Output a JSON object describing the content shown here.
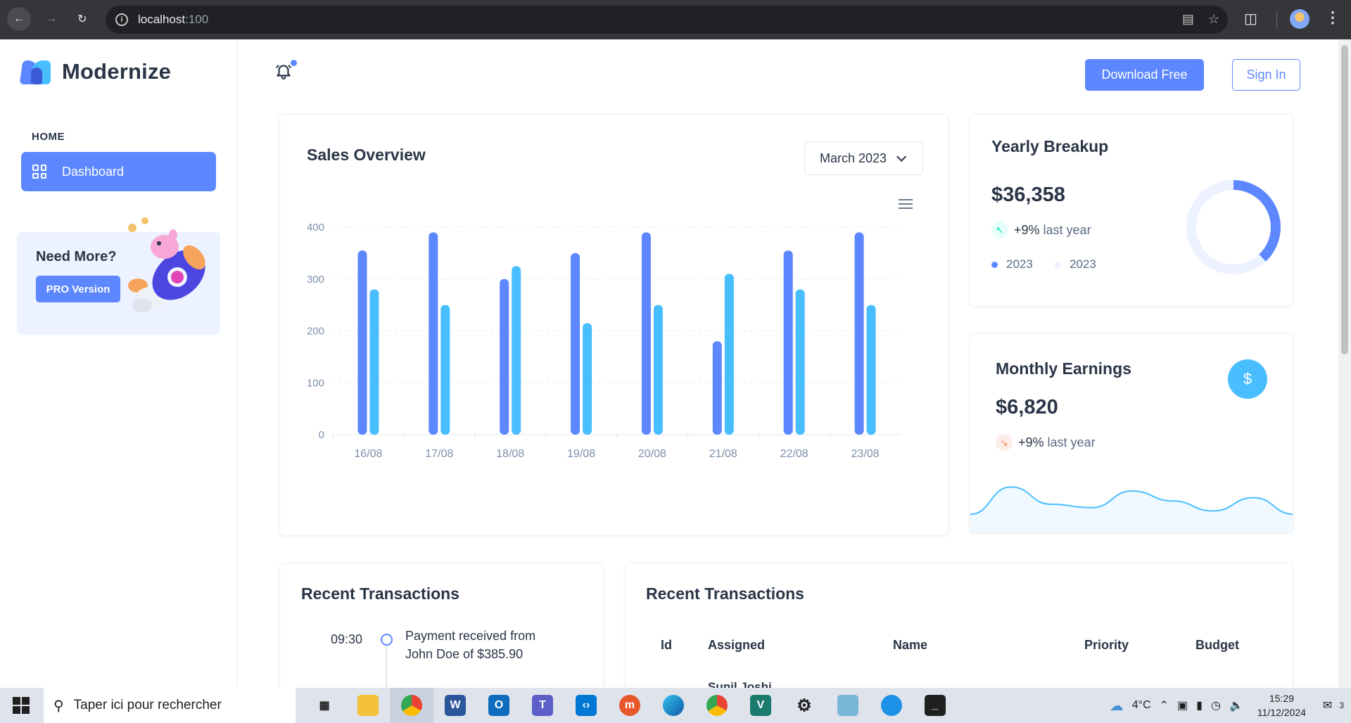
{
  "browser": {
    "url_host": "localhost",
    "url_port": ":100"
  },
  "sidebar": {
    "brand": "Modernize",
    "section_label": "HOME",
    "nav_items": [
      {
        "label": "Dashboard",
        "icon": "dashboard-grid-icon",
        "active": true
      }
    ],
    "promo": {
      "title": "Need More?",
      "button": "PRO Version"
    }
  },
  "header": {
    "notification_icon": "bell-icon",
    "download_button": "Download Free",
    "signin_button": "Sign In"
  },
  "sales_overview": {
    "title": "Sales Overview",
    "period_select": "March 2023",
    "chart_data": {
      "type": "bar",
      "categories": [
        "16/08",
        "17/08",
        "18/08",
        "19/08",
        "20/08",
        "21/08",
        "22/08",
        "23/08"
      ],
      "series": [
        {
          "values": [
            355,
            390,
            300,
            350,
            390,
            180,
            355,
            390
          ]
        },
        {
          "values": [
            280,
            250,
            325,
            215,
            250,
            310,
            280,
            250
          ]
        }
      ],
      "ylim": [
        0,
        400
      ],
      "yticks": [
        0,
        100,
        200,
        300,
        400
      ],
      "grid": true,
      "colors": [
        "#5d87ff",
        "#49beff"
      ]
    }
  },
  "yearly_breakup": {
    "title": "Yearly Breakup",
    "amount": "$36,358",
    "trend": "+9%",
    "trend_suffix": "last year",
    "trend_icon": "arrow-up-left-icon",
    "legend": [
      {
        "label": "2023",
        "color": "#5d87ff"
      },
      {
        "label": "2023",
        "color": "#ecf2ff"
      }
    ],
    "chart_data": {
      "type": "pie",
      "values": [
        38,
        62
      ],
      "colors": [
        "#5d87ff",
        "#ecf2ff"
      ]
    }
  },
  "monthly_earnings": {
    "title": "Monthly Earnings",
    "amount": "$6,820",
    "trend": "+9%",
    "trend_suffix": "last year",
    "trend_icon": "arrow-down-right-icon",
    "currency_icon": "dollar-icon",
    "chart_data": {
      "type": "area",
      "values": [
        25,
        66,
        40,
        35,
        60,
        45,
        30,
        50,
        25
      ],
      "color": "#49beff"
    }
  },
  "recent_transactions_timeline": {
    "title": "Recent Transactions",
    "items": [
      {
        "time": "09:30",
        "text": "Payment received from John Doe of $385.90"
      }
    ]
  },
  "recent_transactions_table": {
    "title": "Recent Transactions",
    "columns": [
      "Id",
      "Assigned",
      "Name",
      "Priority",
      "Budget"
    ],
    "rows": [
      {
        "assigned": "Sunil Joshi"
      }
    ]
  },
  "taskbar": {
    "search_placeholder": "Taper ici pour rechercher",
    "weather": "4°C",
    "time": "15:29",
    "date": "11/12/2024",
    "notification_count": "3"
  }
}
